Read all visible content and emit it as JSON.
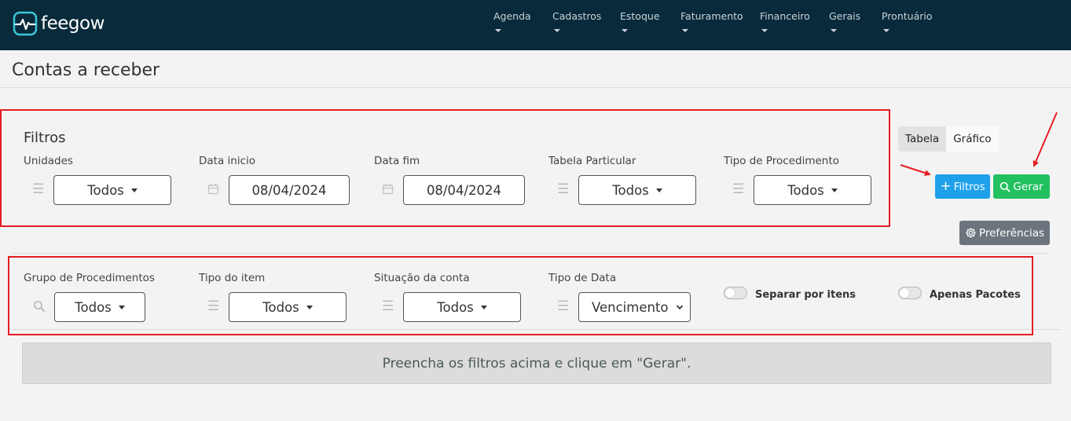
{
  "header": {
    "logo_text": "feegow",
    "nav": [
      "Agenda",
      "Cadastros",
      "Estoque",
      "Faturamento",
      "Financeiro",
      "Gerais",
      "Prontuário"
    ]
  },
  "page": {
    "title": "Contas a receber"
  },
  "filters": {
    "title": "Filtros",
    "unidades": {
      "label": "Unidades",
      "value": "Todos"
    },
    "data_inicio": {
      "label": "Data inicio",
      "value": "08/04/2024"
    },
    "data_fim": {
      "label": "Data fim",
      "value": "08/04/2024"
    },
    "tabela_particular": {
      "label": "Tabela Particular",
      "value": "Todos"
    },
    "tipo_procedimento": {
      "label": "Tipo de Procedimento",
      "value": "Todos"
    },
    "grupo_procedimentos": {
      "label": "Grupo de Procedimentos",
      "value": "Todos"
    },
    "tipo_item": {
      "label": "Tipo do item",
      "value": "Todos"
    },
    "situacao_conta": {
      "label": "Situação da conta",
      "value": "Todos"
    },
    "tipo_data": {
      "label": "Tipo de Data",
      "value": "Vencimento"
    },
    "separar_itens": {
      "label": "Separar por itens",
      "checked": false
    },
    "apenas_pacotes": {
      "label": "Apenas Pacotes",
      "checked": false
    }
  },
  "view_toggle": {
    "tabela": "Tabela",
    "grafico": "Gráfico",
    "active": "Tabela"
  },
  "actions": {
    "filtros": "Filtros",
    "gerar": "Gerar",
    "preferencias": "Preferências"
  },
  "notice": "Preencha os filtros acima e clique em \"Gerar\".",
  "colors": {
    "topbar": "#082a3a",
    "filtros_btn": "#1ea0ea",
    "gerar_btn": "#23c060",
    "pref_btn": "#6c757d",
    "annotation": "#e51c23"
  }
}
